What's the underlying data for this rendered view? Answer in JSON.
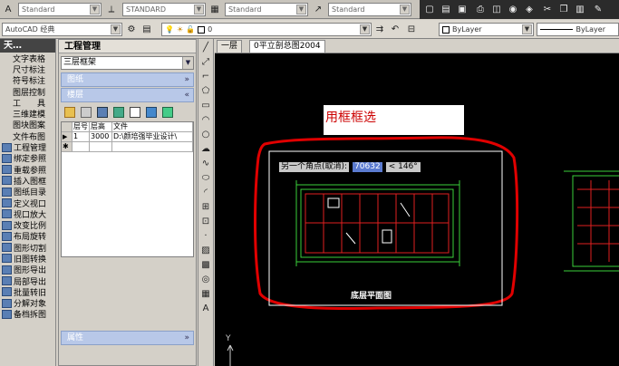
{
  "toolbar1": {
    "combos": [
      "Standard",
      "STANDARD",
      "Standard",
      "Standard"
    ]
  },
  "toolbar2": {
    "workspace": "AutoCAD 经典",
    "layer_value": "0",
    "color_value": "ByLayer",
    "linetype_value": "ByLayer"
  },
  "left_palette": {
    "title": "天…",
    "items": [
      "文字表格",
      "尺寸标注",
      "符号标注",
      "图层控制",
      "工　　具",
      "三维建模",
      "图块图案",
      "文件布图",
      "工程管理",
      "绑定参照",
      "重载参照",
      "插入图框",
      "图纸目录",
      "定义视口",
      "视口放大",
      "改变比例",
      "布局旋转",
      "图形切割",
      "旧图转换",
      "图形导出",
      "局部导出",
      "批量转旧",
      "分解对象",
      "备档拆图"
    ]
  },
  "project_manager": {
    "title": "工程管理",
    "dropdown_value": "三层框架",
    "sections": {
      "drawings": "图纸",
      "floors": "楼层",
      "properties": "属性"
    },
    "table": {
      "headers": [
        "层号",
        "层高",
        "文件"
      ],
      "rows": [
        [
          "1",
          "3000",
          "D:\\颜培强毕业设计\\"
        ],
        [
          "",
          "",
          ""
        ]
      ]
    }
  },
  "tabs": [
    "一层",
    "0平立剖总图2004"
  ],
  "canvas": {
    "annotation": "用框框选",
    "prompt_label": "另一个角点(取消):",
    "prompt_value": "70632",
    "angle_value": "< 146°",
    "plan_title": "底层平面图",
    "ucs_label": "Y"
  },
  "colors": {
    "accent_red": "#e00000",
    "canvas_bg": "#000000",
    "plan_green": "#3ad13a",
    "plan_red": "#e02020"
  }
}
